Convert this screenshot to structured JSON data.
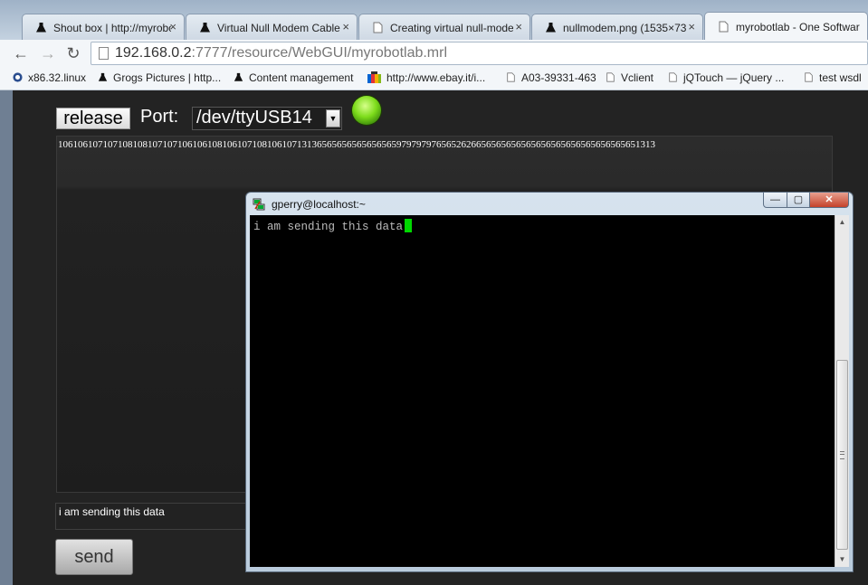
{
  "browser": {
    "tabs": [
      {
        "title": "Shout box | http://myrobc",
        "icon": "flask-icon"
      },
      {
        "title": "Virtual Null Modem Cable",
        "icon": "flask-icon"
      },
      {
        "title": "Creating virtual null-mode",
        "icon": "page-icon"
      },
      {
        "title": "nullmodem.png (1535×73",
        "icon": "flask-icon"
      },
      {
        "title": "myrobotlab - One Softwar",
        "icon": "page-icon",
        "active": true
      }
    ],
    "close_glyph": "×",
    "nav": {
      "back": "←",
      "forward": "→",
      "reload": "↻"
    },
    "url": {
      "host": "192.168.0.2",
      "rest": ":7777/resource/WebGUI/myrobotlab.mrl"
    },
    "bookmarks": [
      {
        "label": "x86.32.linux",
        "icon": "linux-icon"
      },
      {
        "label": "Grogs Pictures | http...",
        "icon": "flask-icon"
      },
      {
        "label": "Content management",
        "icon": "flask-icon"
      },
      {
        "label": "http://www.ebay.it/i...",
        "icon": "ebay-icon"
      },
      {
        "label": "A03-39331-463",
        "icon": "page-icon"
      },
      {
        "label": "Vclient",
        "icon": "page-icon"
      },
      {
        "label": "jQTouch — jQuery ...",
        "icon": "page-icon"
      },
      {
        "label": "test wsdl",
        "icon": "page-icon"
      }
    ]
  },
  "serial": {
    "release_label": "release",
    "port_label": "Port:",
    "port_value": "/dev/ttyUSB14",
    "status_color": "#7ddc1b",
    "received": "106106107107108108107107106106108106107108106107131365656565656565659797979765652626656565656565656565656565656565651313",
    "input_value": "i am sending this data",
    "send_label": "send"
  },
  "putty": {
    "title": "gperry@localhost:~",
    "minimize": "—",
    "maximize": "▢",
    "close": "✕",
    "terminal_line": "i am sending this data",
    "cursor_color": "#00d800"
  }
}
